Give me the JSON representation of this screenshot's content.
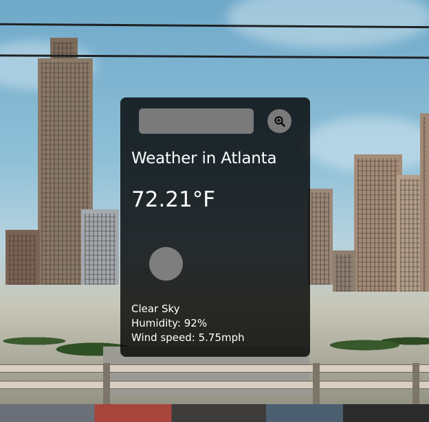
{
  "search": {
    "placeholder": "",
    "value": ""
  },
  "weather": {
    "title": "Weather in Atlanta",
    "temperature": "72.21°F",
    "description": "Clear Sky",
    "humidity": "Humidity: 92%",
    "wind": "Wind speed: 5.75mph"
  },
  "icons": {
    "search_button": "zoom-in-magnifier-icon",
    "weather": "weather-icon"
  },
  "colors": {
    "card_background": "#000000cc",
    "control_gray": "#7a7a7a",
    "text": "#ffffff"
  }
}
